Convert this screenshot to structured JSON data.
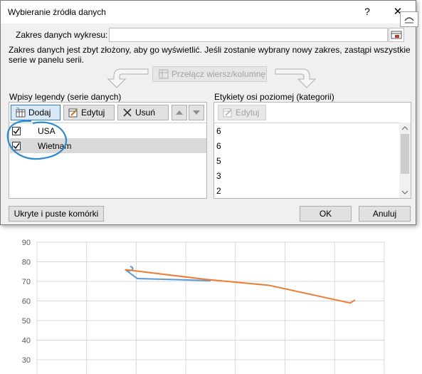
{
  "dialog": {
    "title": "Wybieranie źródła danych",
    "help_label": "?",
    "close_label": "✕",
    "range_label": "Zakres danych wykresu:",
    "range_value": "",
    "message": "Zakres danych jest zbyt złożony, aby go wyświetlić. Jeśli zostanie wybrany nowy zakres, zastąpi wszystkie serie w panelu serii.",
    "switch_label": "Przełącz wiersz/kolumnę"
  },
  "legend_panel": {
    "label": "Wpisy legendy (serie danych)",
    "add_label": "Dodaj",
    "edit_label": "Edytuj",
    "remove_label": "Usuń",
    "series": [
      {
        "name": "USA",
        "checked": true
      },
      {
        "name": "Wietnam",
        "checked": true
      }
    ]
  },
  "category_panel": {
    "label": "Etykiety osi poziomej (kategorii)",
    "edit_label": "Edytuj",
    "values": [
      "6",
      "6",
      "5",
      "3",
      "2"
    ]
  },
  "footer": {
    "hidden_cells_label": "Ukryte i puste komórki",
    "ok_label": "OK",
    "cancel_label": "Anuluj"
  },
  "chart_data": {
    "type": "line",
    "yticks": [
      "90",
      "80",
      "70",
      "60",
      "50",
      "40",
      "30"
    ],
    "ylim": [
      30,
      90
    ],
    "grid": true,
    "series": [
      {
        "color": "#5b9bd5",
        "values": [
          71
        ]
      },
      {
        "color": "#ed7d31",
        "values": [
          74,
          71,
          68,
          59
        ]
      }
    ]
  },
  "colors": {
    "accent": "#2a79d2",
    "annotation": "#2e8bd0",
    "orange": "#ed7d31",
    "blue": "#5b9bd5"
  }
}
